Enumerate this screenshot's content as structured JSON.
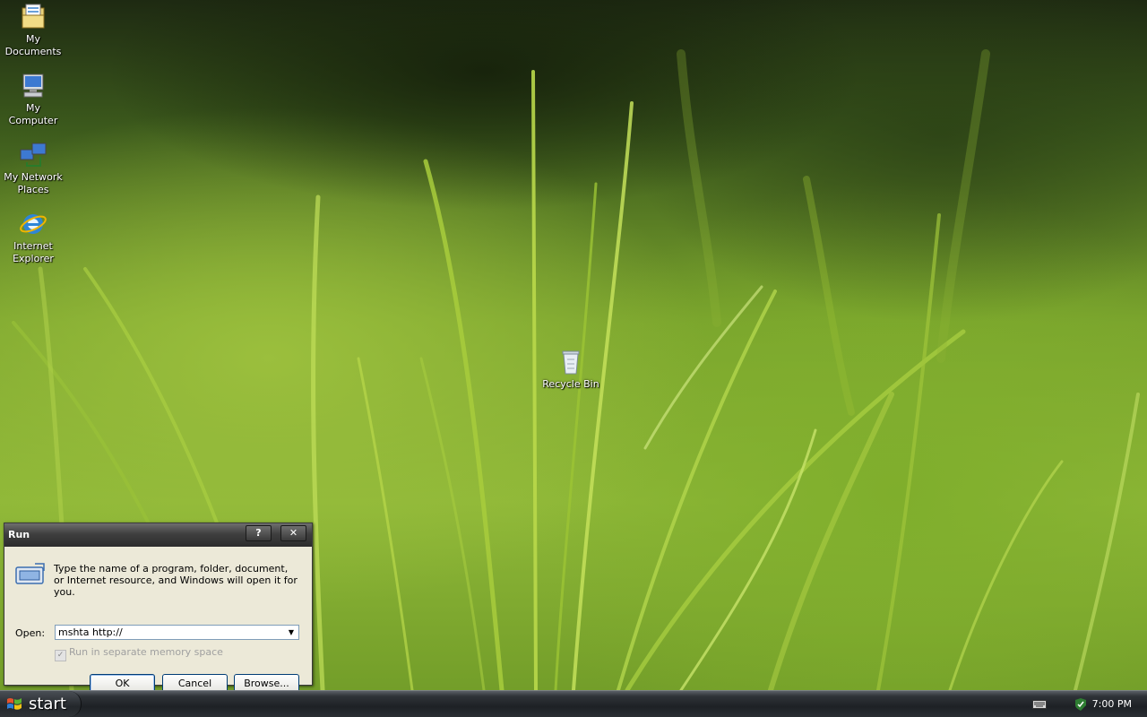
{
  "desktop": {
    "icons": [
      {
        "label": "My Documents",
        "icon": "my-documents-icon"
      },
      {
        "label": "My Computer",
        "icon": "my-computer-icon"
      },
      {
        "label": "My Network Places",
        "icon": "network-places-icon"
      },
      {
        "label": "Internet Explorer",
        "icon": "internet-explorer-icon"
      },
      {
        "label": "Recycle Bin",
        "icon": "recycle-bin-icon"
      }
    ]
  },
  "run_dialog": {
    "title": "Run",
    "help_button": "?",
    "close_button": "✕",
    "description": "Type the name of a program, folder, document, or Internet resource, and Windows will open it for you.",
    "open_label": "Open:",
    "open_value": "mshta http://",
    "checkbox_label": "Run in separate memory space",
    "ok_label": "OK",
    "cancel_label": "Cancel",
    "browse_label": "Browse..."
  },
  "taskbar": {
    "start_label": "start",
    "clock": "7:00 PM"
  },
  "colors": {
    "taskbar": "#1e2125",
    "dialog_bg": "#ece9d8",
    "title_bar": "#3f3f3f"
  }
}
